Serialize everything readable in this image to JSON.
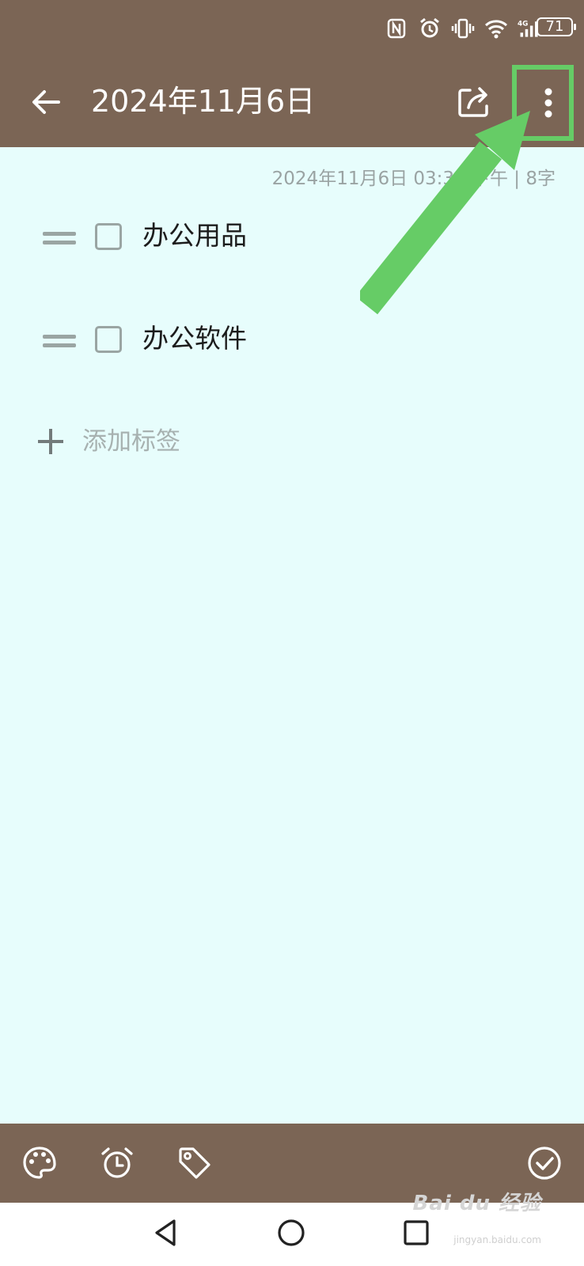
{
  "status_bar": {
    "icons": [
      "nfc-icon",
      "alarm-icon",
      "vibrate-icon",
      "wifi-icon",
      "4g-signal-icon"
    ],
    "battery": "71"
  },
  "header": {
    "title": "2024年11月6日",
    "back_icon": "arrow-left-icon",
    "share_icon": "share-icon",
    "more_icon": "more-vertical-icon"
  },
  "note": {
    "meta": "2024年11月6日 03:37 下午 | 8字",
    "items": [
      {
        "label": "办公用品",
        "checked": false
      },
      {
        "label": "办公软件",
        "checked": false
      }
    ],
    "add_tag_label": "添加标签"
  },
  "toolbar": {
    "buttons": [
      "palette-icon",
      "alarm-clock-icon",
      "tag-icon",
      "check-circle-icon"
    ]
  },
  "nav": {
    "buttons": [
      "back-triangle-icon",
      "home-circle-icon",
      "recents-square-icon"
    ]
  },
  "watermark": {
    "text": "Bai du 经验",
    "sub": "jingyan.baidu.com"
  },
  "colors": {
    "header_bg": "#7b6555",
    "content_bg": "#e7fdfc",
    "highlight": "#66cc66"
  }
}
